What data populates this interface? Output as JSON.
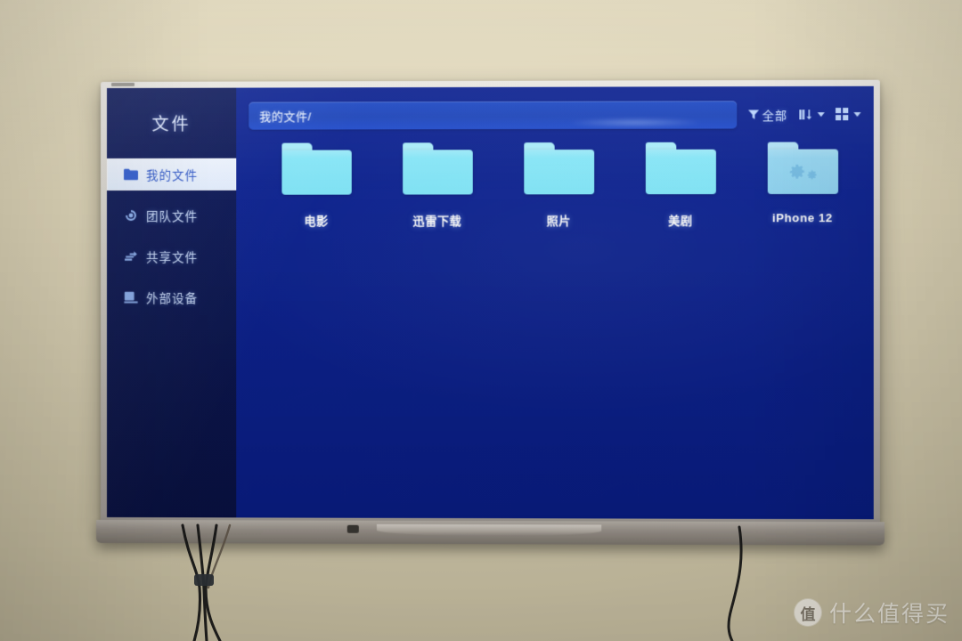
{
  "photo": {
    "wall_color": "#ddd4b7",
    "watermark": {
      "logo_glyph": "值",
      "text": "什么值得买"
    }
  },
  "tv": {
    "bezel_color": "#cdc9c1",
    "brand_badge": ""
  },
  "app": {
    "title": "文件",
    "screen_bg": "#0a2090",
    "sidebar_bg": "#0b1759",
    "accent": "#7fe6f9",
    "sidebar": {
      "items": [
        {
          "label": "我的文件",
          "icon": "folder-icon",
          "active": true
        },
        {
          "label": "团队文件",
          "icon": "team-icon",
          "active": false
        },
        {
          "label": "共享文件",
          "icon": "share-icon",
          "active": false
        },
        {
          "label": "外部设备",
          "icon": "device-icon",
          "active": false
        }
      ]
    },
    "topbar": {
      "path_value": "我的文件/",
      "path_placeholder": "我的文件/",
      "filter_label": "全部",
      "filter_icon": "funnel-icon",
      "sort_icon": "sort-icon",
      "view_icon": "grid-view-icon"
    },
    "files": [
      {
        "name": "电影",
        "type": "folder",
        "system": false
      },
      {
        "name": "迅雷下载",
        "type": "folder",
        "system": false
      },
      {
        "name": "照片",
        "type": "folder",
        "system": false
      },
      {
        "name": "美剧",
        "type": "folder",
        "system": false
      },
      {
        "name": "iPhone 12",
        "type": "folder",
        "system": true
      }
    ]
  }
}
